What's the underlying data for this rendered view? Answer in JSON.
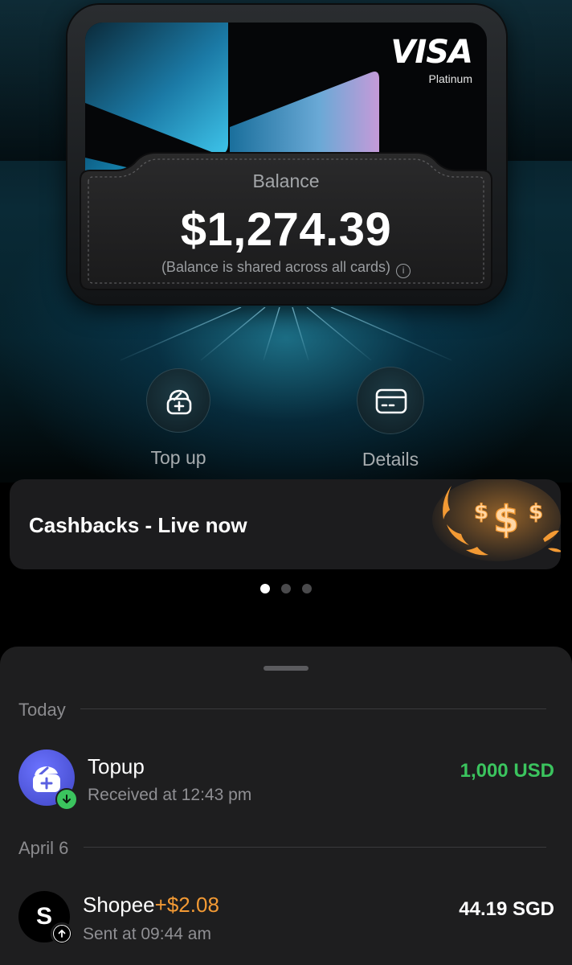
{
  "card": {
    "network": "VISA",
    "tier": "Platinum",
    "balance_label": "Balance",
    "balance_amount": "$1,274.39",
    "balance_note": "(Balance is shared across all cards)",
    "info_icon": "info-icon"
  },
  "actions": [
    {
      "label": "Top up",
      "icon": "wallet-plus-icon"
    },
    {
      "label": "Details",
      "icon": "card-icon"
    }
  ],
  "promo": {
    "title": "Cashbacks - Live now",
    "art_text": "$$$",
    "art_color": "#f39a34"
  },
  "carousel": {
    "count": 3,
    "active_index": 0
  },
  "transactions": {
    "sections": [
      {
        "header": "Today",
        "items": [
          {
            "title": "Topup",
            "cashback": "",
            "subtitle": "Received at 12:43 pm",
            "amount": "1,000 USD",
            "amount_color": "#3bc45e",
            "avatar_icon": "wallet-plus-icon",
            "badge_icon": "arrow-down-icon"
          }
        ]
      },
      {
        "header": "April 6",
        "items": [
          {
            "title": "Shopee",
            "cashback": "+$2.08",
            "subtitle": "Sent at 09:44 am",
            "amount": "44.19 SGD",
            "amount_color": "#ffffff",
            "avatar_letter": "S",
            "badge_icon": "arrow-up-icon"
          }
        ]
      }
    ]
  },
  "colors": {
    "background": "#000000",
    "sheet": "#1e1e1f",
    "positive": "#3bc45e",
    "cashback": "#f39a34",
    "muted": "#8f8f93"
  }
}
